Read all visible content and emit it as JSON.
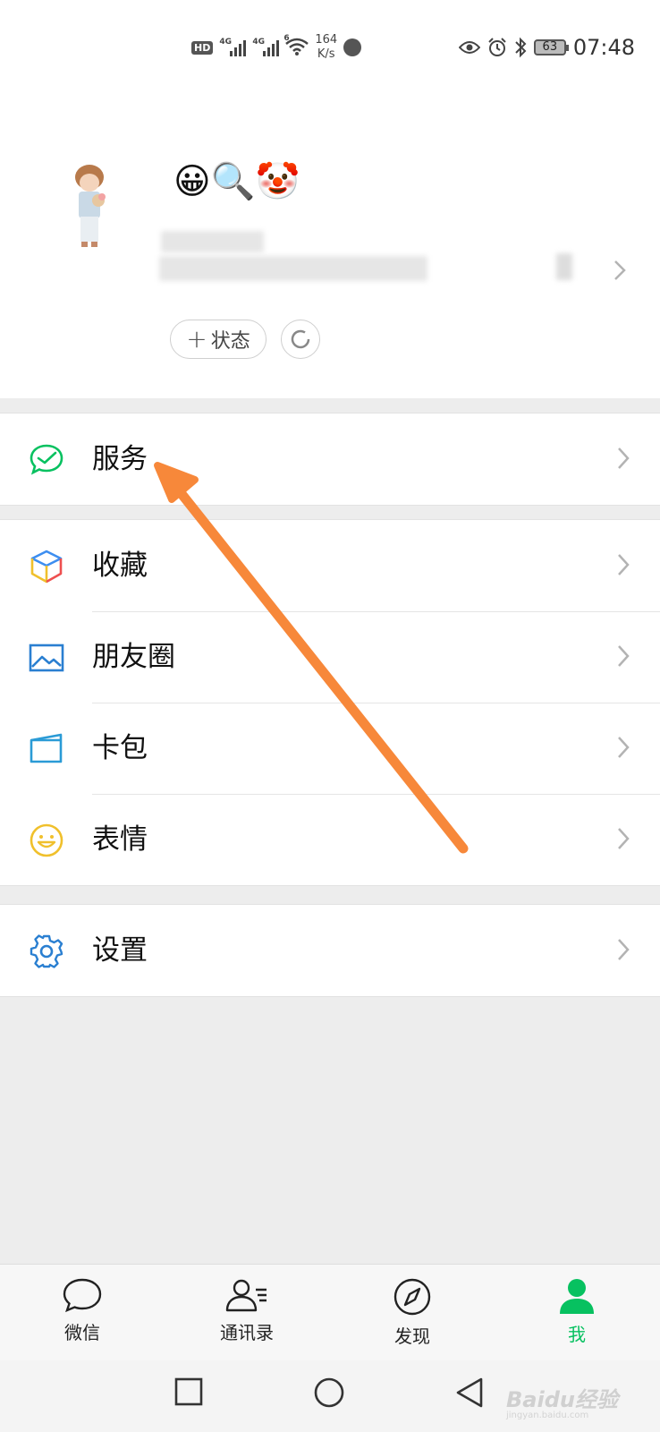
{
  "status_bar": {
    "hd": "HD",
    "net1": "4G",
    "net2": "4G",
    "net3": "6",
    "speed_value": "164",
    "speed_unit": "K/s",
    "battery": "63",
    "time": "07:48"
  },
  "profile": {
    "nickname": "😀🔍🤡",
    "status_button": "状态"
  },
  "menu": {
    "services": "服务",
    "favorites": "收藏",
    "moments": "朋友圈",
    "cards": "卡包",
    "stickers": "表情",
    "settings": "设置"
  },
  "tabs": [
    {
      "label": "微信",
      "icon": "chat-bubble-icon"
    },
    {
      "label": "通讯录",
      "icon": "contacts-icon"
    },
    {
      "label": "发现",
      "icon": "compass-icon"
    },
    {
      "label": "我",
      "icon": "person-icon"
    }
  ],
  "colors": {
    "accent": "#07c160",
    "annotation_arrow": "#f7883a"
  },
  "watermark": {
    "brand": "Baidu经验",
    "url": "jingyan.baidu.com"
  }
}
